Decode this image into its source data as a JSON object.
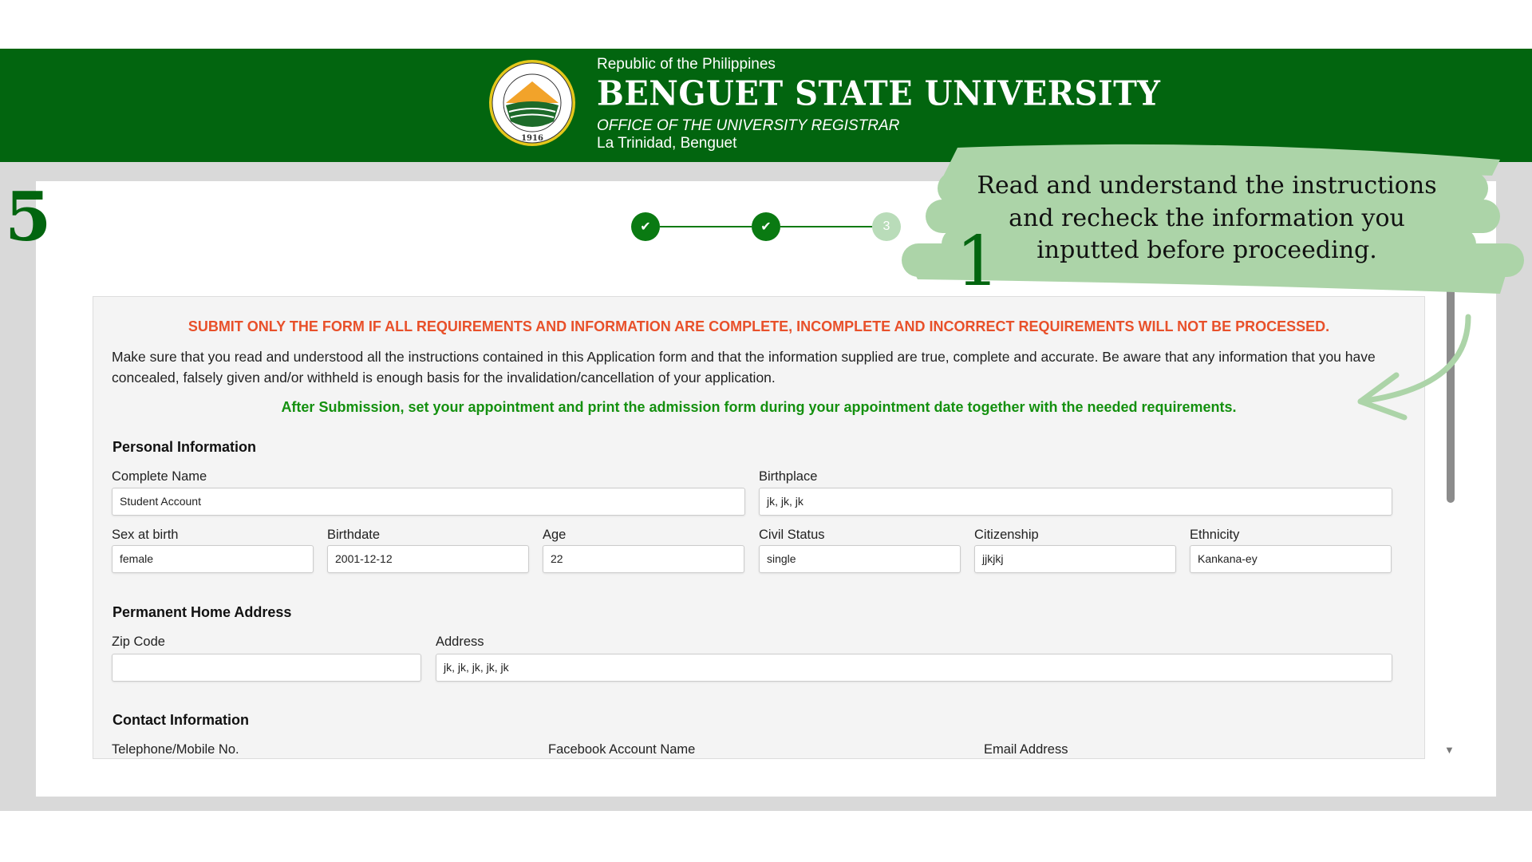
{
  "header": {
    "republic": "Republic of the Philippines",
    "university": "BENGUET STATE UNIVERSITY",
    "office": "OFFICE OF THE UNIVERSITY REGISTRAR",
    "location": "La Trinidad, Benguet",
    "seal_text": "BENGUET STATE UNIVERSITY 1916"
  },
  "tutorial": {
    "step_number": "5",
    "callout": [
      "Read and understand the instructions",
      "and recheck the information you",
      "inputted before proceeding."
    ],
    "marker": "1"
  },
  "stepper": {
    "steps": [
      {
        "state": "done"
      },
      {
        "state": "done"
      },
      {
        "state": "current",
        "label": "3"
      }
    ]
  },
  "form": {
    "warning": "SUBMIT ONLY THE FORM IF ALL REQUIREMENTS AND INFORMATION ARE COMPLETE, INCOMPLETE AND INCORRECT REQUIREMENTS WILL NOT BE PROCESSED.",
    "instructions": "Make sure that you read and understood all the instructions contained in this Application form and that the information supplied are true, complete and accurate. Be aware that any information that you have concealed, falsely given and/or withheld is enough basis for the invalidation/cancellation of your application.",
    "after_submission": "After Submission, set your appointment and print the admission form during your appointment date together with the needed requirements.",
    "personal": {
      "title": "Personal Information",
      "complete_name": {
        "label": "Complete Name",
        "value": "Student  Account"
      },
      "birthplace": {
        "label": "Birthplace",
        "value": "jk, jk, jk"
      },
      "sex": {
        "label": "Sex at birth",
        "value": "female"
      },
      "birthdate": {
        "label": "Birthdate",
        "value": "2001-12-12"
      },
      "age": {
        "label": "Age",
        "value": "22"
      },
      "civil_status": {
        "label": "Civil Status",
        "value": "single"
      },
      "citizenship": {
        "label": "Citizenship",
        "value": "jjkjkj"
      },
      "ethnicity": {
        "label": "Ethnicity",
        "value": "Kankana-ey"
      }
    },
    "address": {
      "title": "Permanent Home Address",
      "zip": {
        "label": "Zip Code",
        "value": ""
      },
      "address": {
        "label": "Address",
        "value": "jk, jk, jk, jk, jk"
      }
    },
    "contact": {
      "title": "Contact Information",
      "phone_label": "Telephone/Mobile No.",
      "facebook_label": "Facebook Account Name",
      "email_label": "Email Address"
    }
  },
  "colors": {
    "brand_green": "#02650f",
    "warning": "#e8502a",
    "success": "#14900f",
    "callout": "#acd4a8"
  }
}
